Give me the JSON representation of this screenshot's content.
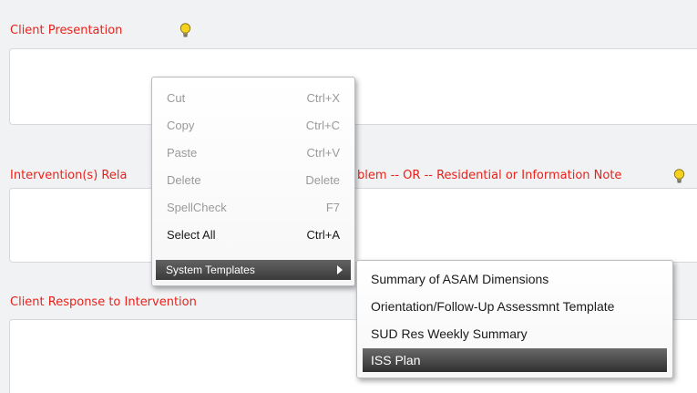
{
  "form": {
    "client_presentation_label": "Client Presentation",
    "intervention_label_left": "Intervention(s) Rela",
    "intervention_label_right": "blem -- OR -- Residential or Information Note",
    "client_response_label": "Client Response to Intervention",
    "hint_icon": "lightbulb-icon"
  },
  "context_menu": {
    "items": [
      {
        "label": "Cut",
        "shortcut": "Ctrl+X",
        "enabled": false
      },
      {
        "label": "Copy",
        "shortcut": "Ctrl+C",
        "enabled": false
      },
      {
        "label": "Paste",
        "shortcut": "Ctrl+V",
        "enabled": false
      },
      {
        "label": "Delete",
        "shortcut": "Delete",
        "enabled": false
      },
      {
        "label": "SpellCheck",
        "shortcut": "F7",
        "enabled": false
      },
      {
        "label": "Select All",
        "shortcut": "Ctrl+A",
        "enabled": true
      }
    ],
    "submenu_label": "System Templates",
    "submenu_arrow_icon": "chevron-right-icon"
  },
  "templates_submenu": {
    "items": [
      {
        "label": "Summary of ASAM Dimensions",
        "active": false
      },
      {
        "label": "Orientation/Follow-Up Assessmnt Template",
        "active": false
      },
      {
        "label": "SUD Res Weekly Summary",
        "active": false
      },
      {
        "label": "ISS Plan",
        "active": true
      }
    ]
  },
  "colors": {
    "label_red": "#e8221b",
    "menu_highlight": "#3a3a3a",
    "background": "#f1f2f4"
  }
}
